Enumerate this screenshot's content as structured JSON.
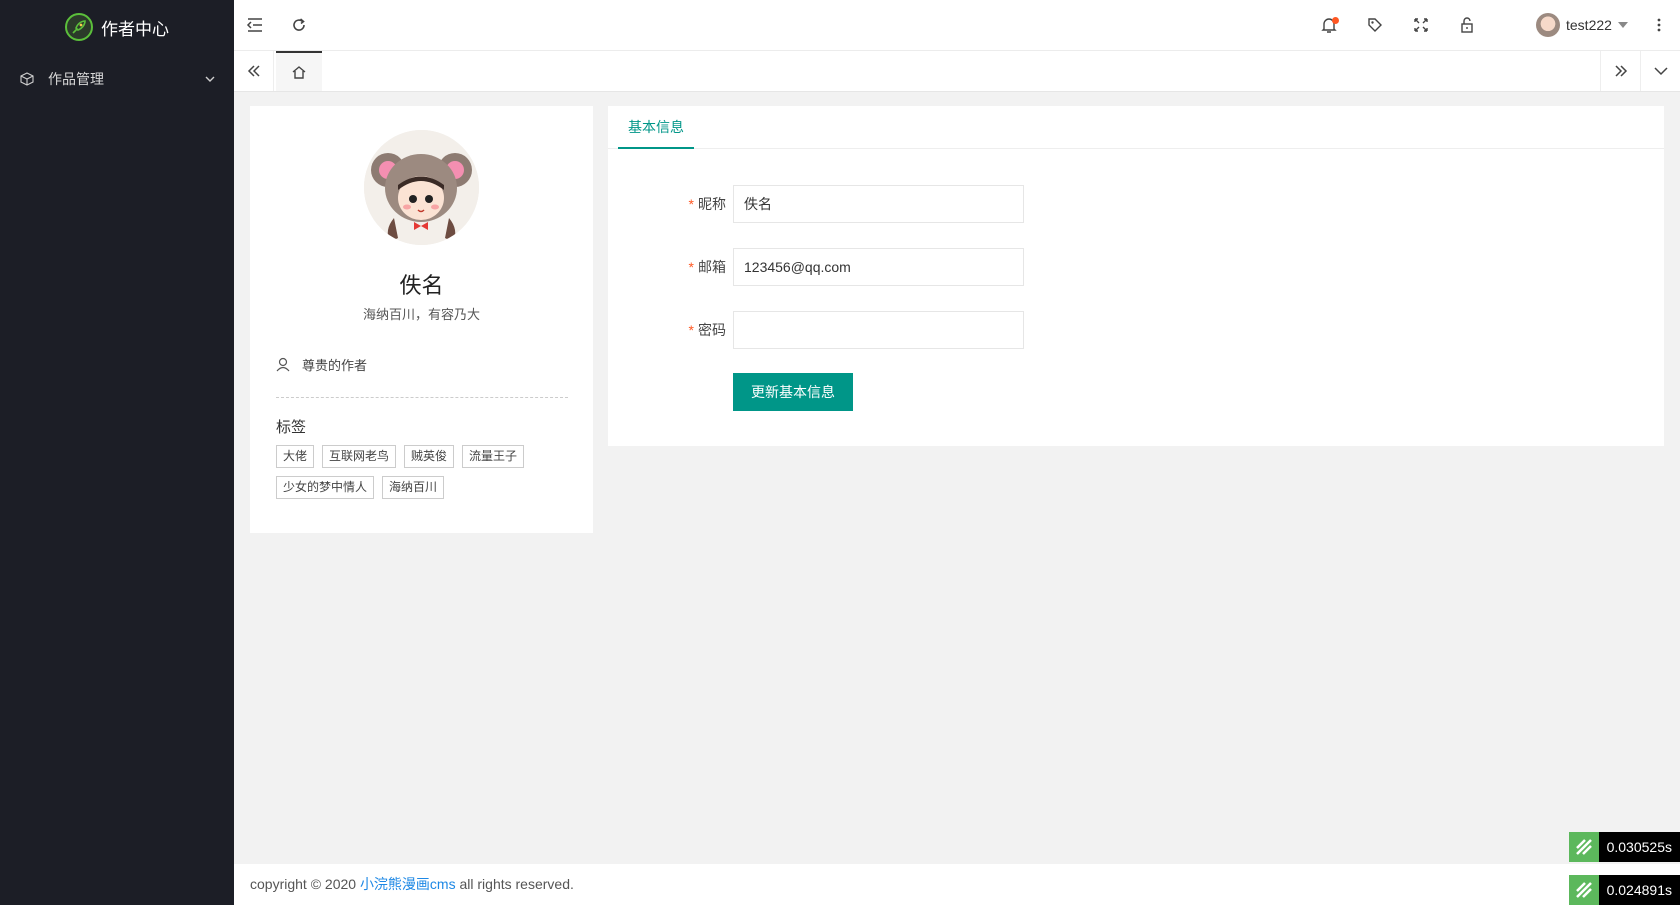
{
  "sidebar": {
    "app_title": "作者中心",
    "items": [
      {
        "label": "作品管理"
      }
    ]
  },
  "header": {
    "username": "test222"
  },
  "profile": {
    "name": "佚名",
    "motto": "海纳百川，有容乃大",
    "role": "尊贵的作者",
    "tags_title": "标签",
    "tags": [
      "大佬",
      "互联网老鸟",
      "贼英俊",
      "流量王子",
      "少女的梦中情人",
      "海纳百川"
    ]
  },
  "info": {
    "tab_label": "基本信息",
    "fields": {
      "nickname": {
        "label": "昵称",
        "value": "佚名"
      },
      "email": {
        "label": "邮箱",
        "value": "123456@qq.com"
      },
      "password": {
        "label": "密码",
        "value": ""
      }
    },
    "required_mark": "*",
    "submit_label": "更新基本信息"
  },
  "footer": {
    "prefix": "copyright © 2020 ",
    "link": "小浣熊漫画cms",
    "suffix": " all rights reserved."
  },
  "timers": [
    "0.030525s",
    "0.024891s"
  ],
  "colors": {
    "sidebar_bg": "#1c1e26",
    "accent": "#009688",
    "required": "#ff5722",
    "link": "#1e88e5"
  }
}
